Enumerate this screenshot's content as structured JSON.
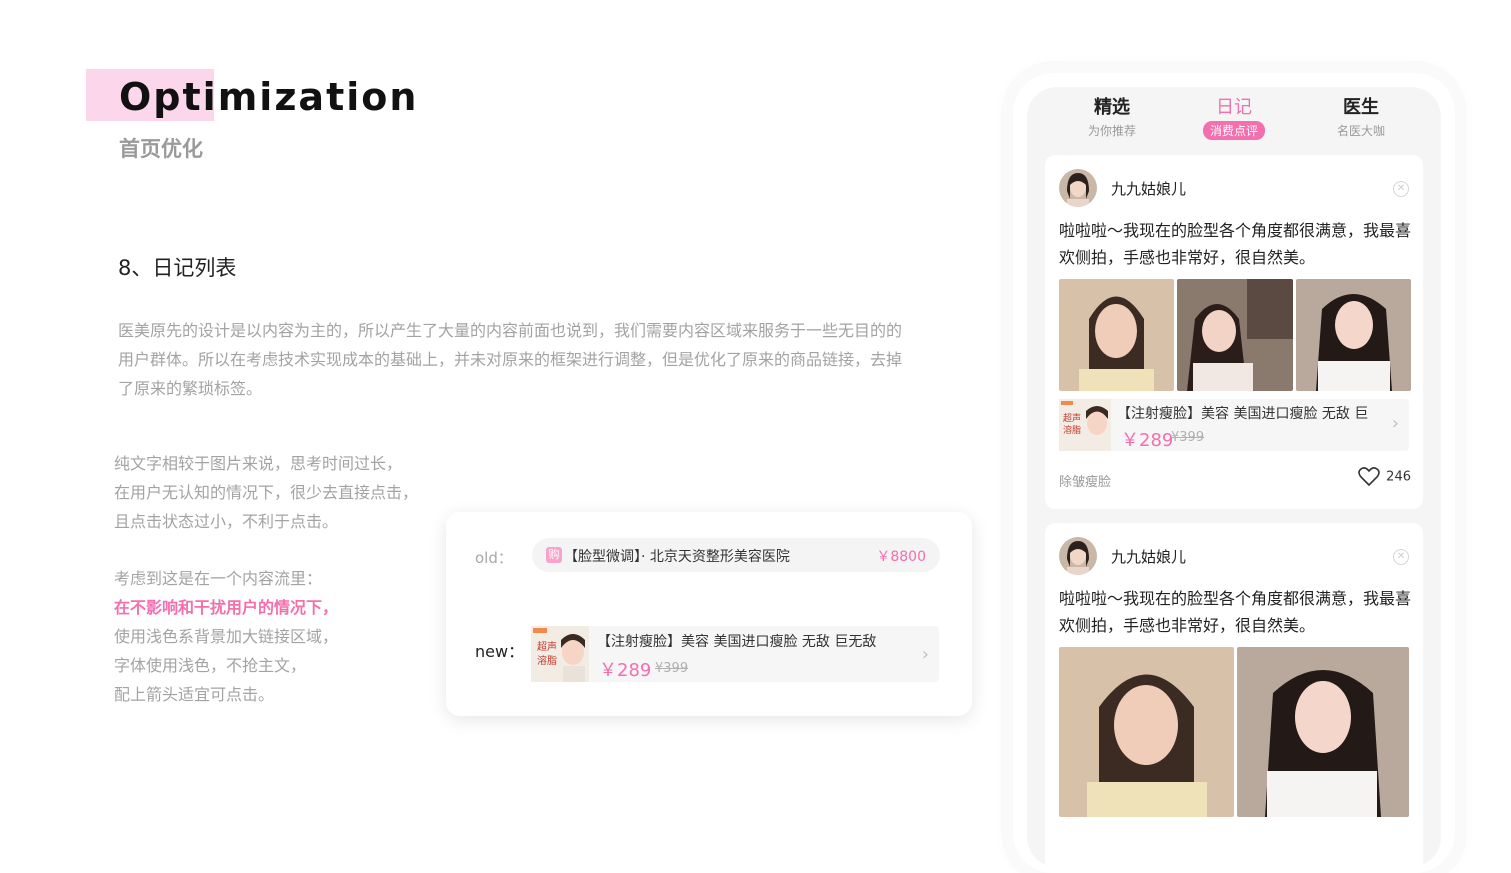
{
  "header": {
    "title": "Optimization",
    "subtitle": "首页优化"
  },
  "section": {
    "heading": "8、日记列表",
    "paragraph": "医美原先的设计是以内容为主的，所以产生了大量的内容前面也说到，我们需要内容区域来服务于一些无目的的用户群体。所以在考虑技术实现成本的基础上，并未对原来的框架进行调整，但是优化了原来的商品链接，去掉了原来的繁琐标签。"
  },
  "notes": {
    "lines1": [
      "纯文字相较于图片来说，思考时间过长，",
      "在用户无认知的情况下，很少去直接点击，",
      "且点击状态过小，不利于点击。"
    ],
    "line_intro": "考虑到这是在一个内容流里：",
    "line_highlight": "在不影响和干扰用户的情况下，",
    "lines2": [
      "使用浅色系背景加大链接区域，",
      "字体使用浅色，不抢主文，",
      "配上箭头适宜可点击。"
    ]
  },
  "compare": {
    "old_label": "old：",
    "old_tag": "购",
    "old_text": "【脸型微调】· 北京天资整形美容医院",
    "old_price": "￥8800",
    "new_label": "new：",
    "new_title": "【注射瘦脸】美容 美国进口瘦脸 无敌 巨无敌",
    "new_price": "￥289",
    "new_orig": "¥399"
  },
  "phone": {
    "tabs": [
      {
        "label": "精选",
        "sub": "为你推荐",
        "active": false
      },
      {
        "label": "日记",
        "sub": "消费点评",
        "active": true
      },
      {
        "label": "医生",
        "sub": "名医大咖",
        "active": false
      }
    ],
    "posts": [
      {
        "username": "九九姑娘儿",
        "text": "啦啦啦～我现在的脸型各个角度都很满意，我最喜欢侧拍，手感也非常好，很自然美。",
        "product_title": "【注射瘦脸】美容 美国进口瘦脸 无敌 巨",
        "price": "￥289",
        "orig": "¥399",
        "tag": "除皱瘦脸",
        "likes": "246"
      },
      {
        "username": "九九姑娘儿",
        "text": "啦啦啦～我现在的脸型各个角度都很满意，我最喜欢侧拍，手感也非常好，很自然美。"
      }
    ]
  },
  "colors": {
    "accent": "#f36fae",
    "highlight": "#fcd6ea"
  }
}
